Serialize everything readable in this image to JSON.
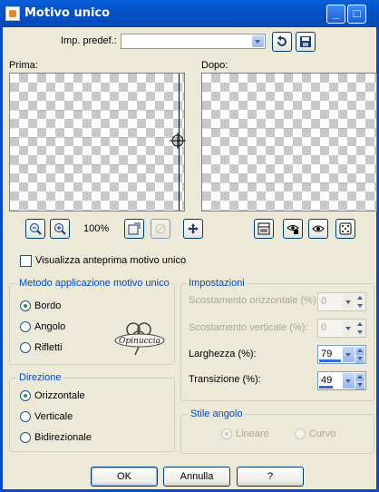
{
  "window": {
    "title": "Motivo unico"
  },
  "preset": {
    "label": "Imp. predef.:",
    "value": ""
  },
  "preview": {
    "before_label": "Prima:",
    "after_label": "Dopo:",
    "zoom": "100%"
  },
  "preview_checkbox": {
    "label": "Visualizza anteprima motivo unico",
    "checked": false
  },
  "method_group": {
    "title": "Metodo applicazione motivo unico",
    "options": [
      "Bordo",
      "Angolo",
      "Rifletti"
    ],
    "selected": "Bordo"
  },
  "direction_group": {
    "title": "Direzione",
    "options": [
      "Orizzontale",
      "Verticale",
      "Bidirezionale"
    ],
    "selected": "Orizzontale"
  },
  "settings_group": {
    "title": "Impostazioni",
    "h_offset": {
      "label": "Scostamento orizzontale (%):",
      "value": "0",
      "enabled": false
    },
    "v_offset": {
      "label": "Scostamento verticale (%):",
      "value": "0",
      "enabled": false
    },
    "width": {
      "label": "Larghezza (%):",
      "value": "79"
    },
    "transition": {
      "label": "Transizione (%):",
      "value": "49"
    }
  },
  "corner_group": {
    "title": "Stile angolo",
    "options": [
      "Lineare",
      "Curvo"
    ],
    "selected": "Lineare",
    "enabled": false
  },
  "buttons": {
    "ok": "OK",
    "cancel": "Annulla",
    "help": "?"
  },
  "watermark": {
    "text": "Opinuccia"
  }
}
